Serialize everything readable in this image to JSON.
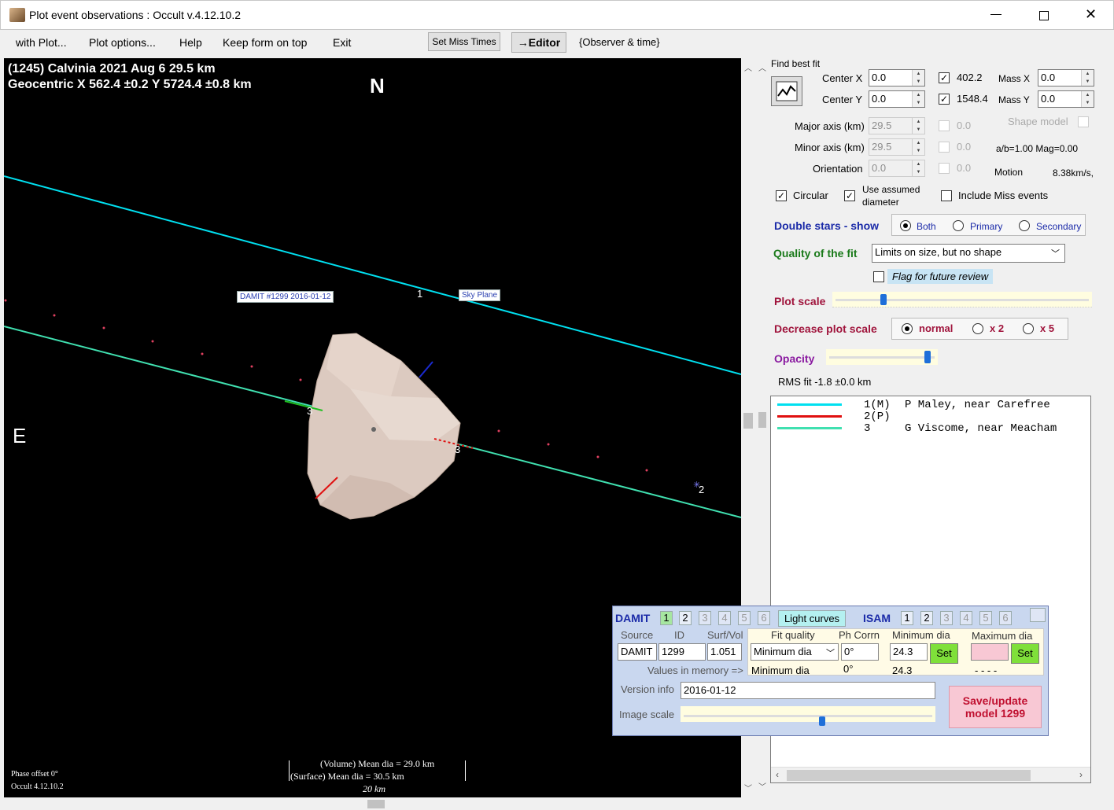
{
  "window": {
    "title": "Plot event observations : Occult v.4.12.10.2"
  },
  "menu": {
    "with_plot": "with Plot...",
    "plot_options": "Plot options...",
    "help": "Help",
    "keep_on_top": "Keep form on top",
    "exit": "Exit",
    "set_miss_times": "Set Miss Times",
    "editor": "→Editor",
    "observer_time": "{Observer & time}"
  },
  "plot": {
    "line1": "(1245) Calvinia  2021 Aug 6   29.5 km",
    "line2": "Geocentric  X  562.4 ±0.2  Y 5724.4 ±0.8 km",
    "north": "N",
    "east": "E",
    "damit_tag": "DAMIT #1299 2016-01-12",
    "sky_plane": "Sky Plane",
    "chord_labels": [
      "1",
      "3",
      "3",
      "2"
    ],
    "phase_offset": "Phase offset 0°",
    "occult_ver": "Occult 4.12.10.2",
    "volume_dia": "(Volume) Mean dia = 29.0 km",
    "surface_dia": "(Surface) Mean dia = 30.5 km",
    "scale_label": "20 km"
  },
  "fit": {
    "find_best_fit": "Find best fit",
    "center_x_label": "Center X",
    "center_x": "0.0",
    "center_y_label": "Center Y",
    "center_y": "0.0",
    "check_402": "402.2",
    "check_1548": "1548.4",
    "mass_x_label": "Mass X",
    "mass_x": "0.0",
    "mass_y_label": "Mass Y",
    "mass_y": "0.0",
    "major_label": "Major axis (km)",
    "major": "29.5",
    "minor_label": "Minor axis (km)",
    "minor": "29.5",
    "orient_label": "Orientation",
    "orient": "0.0",
    "zero1": "0.0",
    "zero2": "0.0",
    "zero3": "0.0",
    "shape_model": "Shape model",
    "ab_mag": "a/b=1.00  Mag=0.00",
    "motion_label": "Motion",
    "motion": "8.38km/s,",
    "circular": "Circular",
    "use_assumed": "Use assumed",
    "diameter": "diameter",
    "include_miss": "Include Miss events"
  },
  "double_stars": {
    "label": "Double stars - show",
    "both": "Both",
    "primary": "Primary",
    "secondary": "Secondary"
  },
  "quality": {
    "label": "Quality of the fit",
    "value": "Limits on size, but no shape",
    "flag": "Flag for future review"
  },
  "plot_scale": {
    "label": "Plot scale",
    "value": 0.18
  },
  "decrease": {
    "label": "Decrease plot scale",
    "normal": "normal",
    "x2": "x 2",
    "x5": "x 5"
  },
  "opacity": {
    "label": "Opacity",
    "value": 0.93
  },
  "rms": "RMS fit -1.8 ±0.0 km",
  "observers": [
    {
      "num": "1(M)",
      "name": "P Maley, near Carefree",
      "color": "#00e0f0"
    },
    {
      "num": "2(P)",
      "name": "",
      "color": "#e01010"
    },
    {
      "num": "3",
      "name": "G Viscome, near Meacham",
      "color": "#40e0b0"
    }
  ],
  "damit": {
    "damit": "DAMIT",
    "tabs": [
      "1",
      "2",
      "3",
      "4",
      "5",
      "6"
    ],
    "light_curves": "Light curves",
    "isam": "ISAM",
    "source_label": "Source",
    "id_label": "ID",
    "surf_vol_label": "Surf/Vol",
    "source": "DAMIT",
    "id": "1299",
    "surf_vol": "1.051",
    "fit_quality_label": "Fit quality",
    "ph_corr_label": "Ph Corrn",
    "min_dia_label": "Minimum dia",
    "max_dia_label": "Maximum dia",
    "fit_quality": "Minimum dia",
    "ph_corr": "0°",
    "min_dia": "24.3",
    "set": "Set",
    "values_mem": "Values in memory =>",
    "mem_fit": "Minimum dia",
    "mem_ph": "0°",
    "mem_min": "24.3",
    "mem_max": "- - - -",
    "version_label": "Version info",
    "version": "2016-01-12",
    "image_scale": "Image scale",
    "save": "Save/update",
    "model": "model  1299",
    "image_scale_value": 0.55
  }
}
